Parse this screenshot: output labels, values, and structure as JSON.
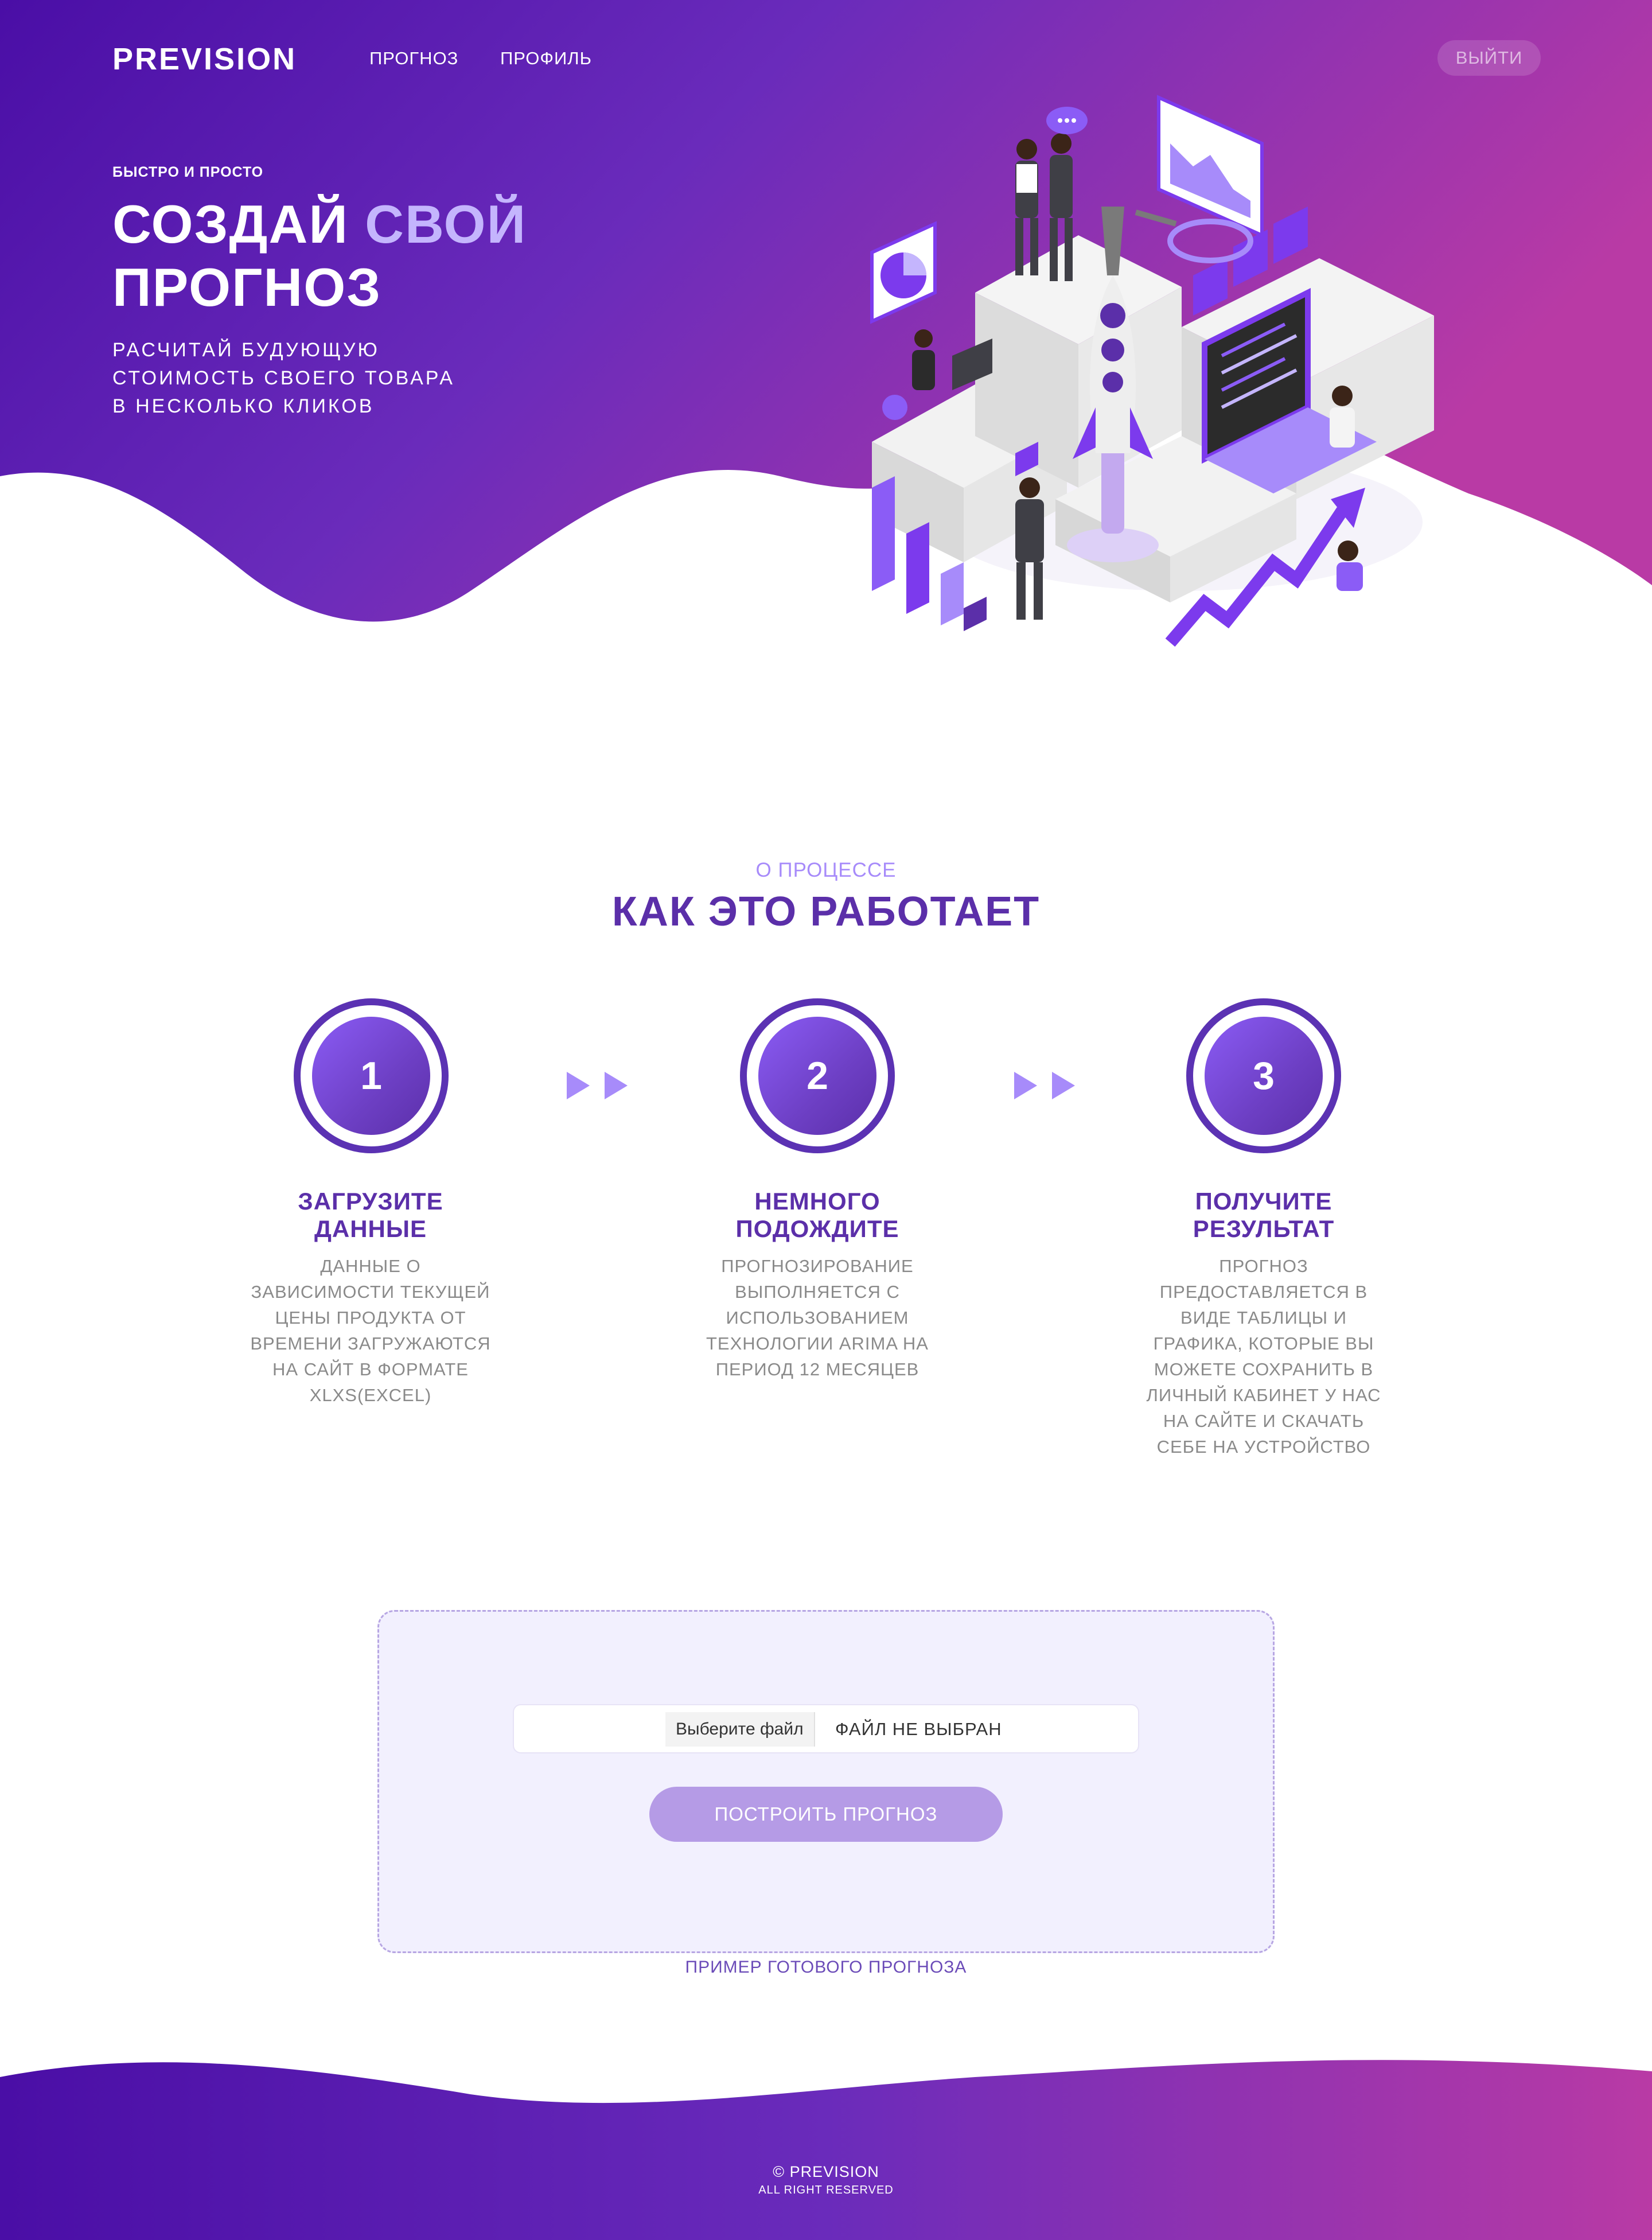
{
  "colors": {
    "gradient_start": "#4a0ea6",
    "gradient_mid": "#6a2bbb",
    "gradient_end": "#b93aa5",
    "accent_text": "#c4b5fd",
    "primary_text": "#5b2fa9",
    "muted_text": "#8a8a8a",
    "button_bg": "#b59be6",
    "upload_bg": "#f2f0fe"
  },
  "nav": {
    "logo": "PREVISION",
    "links": [
      "ПРОГНОЗ",
      "ПРОФИЛЬ"
    ],
    "logout": "ВЫЙТИ"
  },
  "hero": {
    "eyebrow": "БЫСТРО И ПРОСТО",
    "title_part1": "СОЗДАЙ ",
    "title_accent": "СВОЙ",
    "title_part2": "ПРОГНОЗ",
    "subtitle_lines": [
      "РАСЧИТАЙ БУДУЮЩУЮ",
      "СТОИМОСТЬ СВОЕГО ТОВАРА",
      "В НЕСКОЛЬКО КЛИКОВ"
    ],
    "illustration": "startup-rocket-isometric-illustration"
  },
  "process": {
    "eyebrow": "О ПРОЦЕССЕ",
    "title": "КАК ЭТО РАБОТАЕТ",
    "steps": [
      {
        "number": "1",
        "title_lines": [
          "ЗАГРУЗИТЕ",
          "ДАННЫЕ"
        ],
        "desc_lines": [
          "ДАННЫЕ О",
          "ЗАВИСИМОСТИ ТЕКУЩЕЙ",
          "ЦЕНЫ ПРОДУКТА ОТ",
          "ВРЕМЕНИ ЗАГРУЖАЮТСЯ",
          "НА САЙТ В ФОРМАТЕ",
          "XLXS(EXCEL)"
        ]
      },
      {
        "number": "2",
        "title_lines": [
          "НЕМНОГО",
          "ПОДОЖДИТЕ"
        ],
        "desc_lines": [
          "ПРОГНОЗИРОВАНИЕ",
          "ВЫПОЛНЯЕТСЯ С",
          "ИСПОЛЬЗОВАНИЕМ",
          "ТЕХНОЛОГИИ ARIMA НА",
          "ПЕРИОД 12 МЕСЯЦЕВ"
        ]
      },
      {
        "number": "3",
        "title_lines": [
          "ПОЛУЧИТЕ",
          "РЕЗУЛЬТАТ"
        ],
        "desc_lines": [
          "ПРОГНОЗ",
          "ПРЕДОСТАВЛЯЕТСЯ В",
          "ВИДЕ ТАБЛИЦЫ И",
          "ГРАФИКА, КОТОРЫЕ ВЫ",
          "МОЖЕТЕ СОХРАНИТЬ В",
          "ЛИЧНЫЙ КАБИНЕТ У НАС",
          "НА САЙТЕ И СКАЧАТЬ",
          "СЕБЕ НА УСТРОЙСТВО"
        ]
      }
    ]
  },
  "upload": {
    "file_button": "Выберите файл",
    "file_status": "ФАЙЛ НЕ ВЫБРАН",
    "submit": "ПОСТРОИТЬ ПРОГНОЗ",
    "example_link": "ПРИМЕР ГОТОВОГО ПРОГНОЗА"
  },
  "footer": {
    "copyright": "© PREVISION",
    "rights": "ALL RIGHT RESERVED"
  }
}
